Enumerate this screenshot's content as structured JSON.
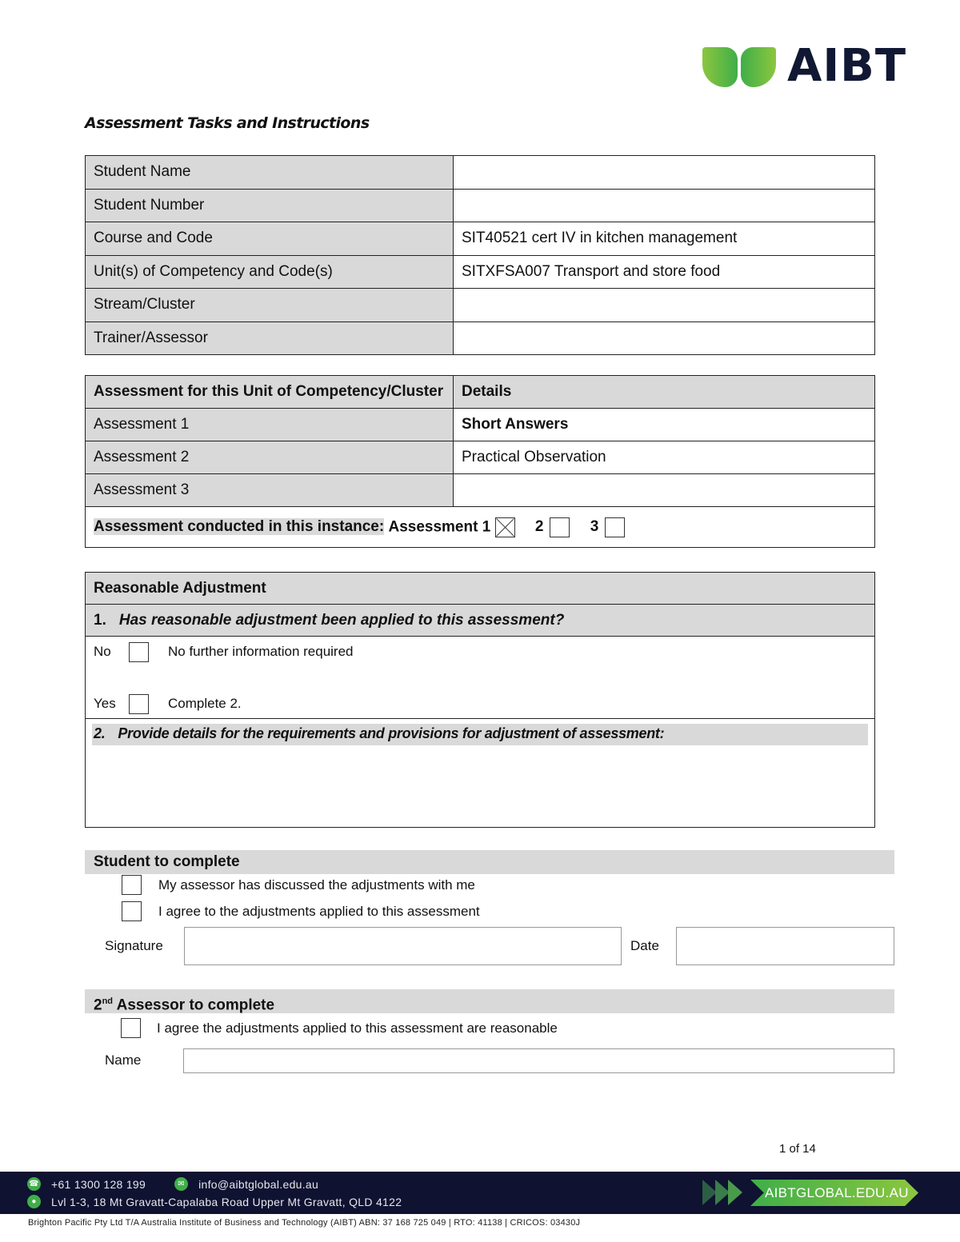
{
  "logo": {
    "text": "AIBT"
  },
  "title": "Assessment Tasks and Instructions",
  "student_info": [
    {
      "label": "Student Name",
      "value": ""
    },
    {
      "label": "Student Number",
      "value": ""
    },
    {
      "label": "Course and Code",
      "value": "SIT40521 cert IV in kitchen management"
    },
    {
      "label": "Unit(s) of Competency and Code(s)",
      "value": "SITXFSA007 Transport and store food"
    },
    {
      "label": "Stream/Cluster",
      "value": ""
    },
    {
      "label": "Trainer/Assessor",
      "value": ""
    }
  ],
  "assessments": {
    "header_label": "Assessment for this Unit of Competency/Cluster",
    "header_details": "Details",
    "rows": [
      {
        "label": "Assessment 1",
        "details": "Short Answers"
      },
      {
        "label": "Assessment 2",
        "details": "Practical Observation"
      },
      {
        "label": "Assessment 3",
        "details": ""
      }
    ],
    "conducted_label": "Assessment conducted in this instance:",
    "conducted_prefix": "Assessment 1",
    "options": [
      {
        "label": "1",
        "checked": true
      },
      {
        "label": "2",
        "checked": false
      },
      {
        "label": "3",
        "checked": false
      }
    ]
  },
  "reasonable_adjustment": {
    "header": "Reasonable Adjustment",
    "q1_num": "1.",
    "q1": "Has reasonable adjustment been applied to this assessment?",
    "no_label": "No",
    "no_text": "No further information required",
    "yes_label": "Yes",
    "yes_text": "Complete 2.",
    "q2_num": "2.",
    "q2": "Provide details for the requirements and provisions for adjustment of assessment:"
  },
  "student_section": {
    "header": "Student to complete",
    "items": [
      "My assessor has discussed the adjustments with me",
      "I agree to the adjustments applied to this assessment"
    ],
    "signature_label": "Signature",
    "date_label": "Date"
  },
  "assessor_section": {
    "header_prefix": "2",
    "header_sup": "nd",
    "header_suffix": " Assessor to complete",
    "item": "I agree the adjustments applied to this assessment are reasonable",
    "name_label": "Name"
  },
  "page": "1 of 14",
  "footer": {
    "phone": "+61 1300 128 199",
    "email": "info@aibtglobal.edu.au",
    "address": "Lvl 1-3, 18 Mt Gravatt-Capalaba Road Upper Mt Gravatt, QLD 4122",
    "website": "AIBTGLOBAL.EDU.AU",
    "legal": "Brighton Pacific Pty Ltd T/A Australia Institute of Business and Technology (AIBT) ABN: 37 168 725 049 | RTO: 41138 | CRICOS: 03430J"
  },
  "colors": {
    "brand_green": "#3fae49",
    "brand_navy": "#0f1230",
    "shade": "#d9d9d9"
  }
}
